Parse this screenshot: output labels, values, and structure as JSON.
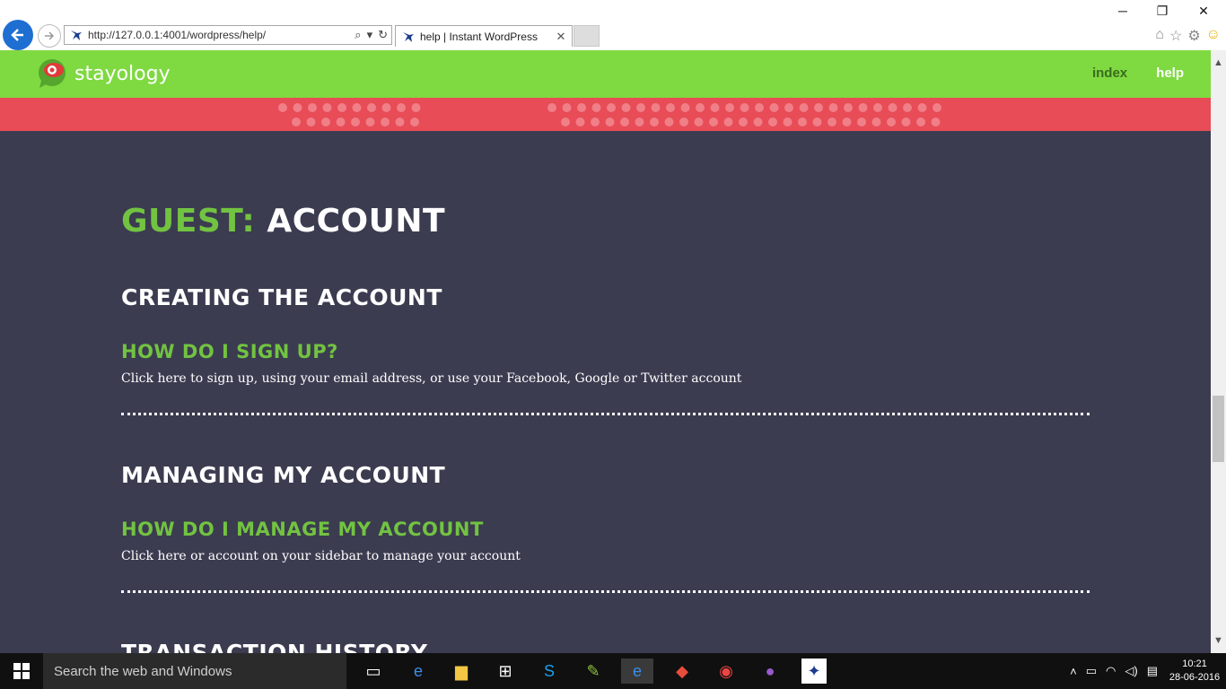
{
  "browser": {
    "url": "http://127.0.0.1:4001/wordpress/help/",
    "tab_title": "help | Instant WordPress",
    "minimize": "─",
    "restore": "❐",
    "close": "✕"
  },
  "site": {
    "logo_text": "stayology",
    "nav": {
      "index": "index",
      "help": "help"
    }
  },
  "page": {
    "title_prefix": "GUEST:",
    "title_main": "ACCOUNT",
    "sections": [
      {
        "title": "CREATING THE ACCOUNT",
        "question": "HOW DO I SIGN UP?",
        "answer": "Click here to sign up, using your email address, or use your Facebook, Google or Twitter account"
      },
      {
        "title": "MANAGING MY ACCOUNT",
        "question": "HOW DO I MANAGE MY ACCOUNT",
        "answer": "Click here or account on your sidebar to manage your account"
      },
      {
        "title": "TRANSACTION HISTORY"
      }
    ]
  },
  "taskbar": {
    "search_placeholder": "Search the web and Windows",
    "time": "10:21",
    "date": "28-06-2016"
  },
  "colors": {
    "header_green": "#7fd941",
    "banner_red": "#e74c57",
    "page_bg": "#3b3c50",
    "accent_green": "#72c341"
  }
}
